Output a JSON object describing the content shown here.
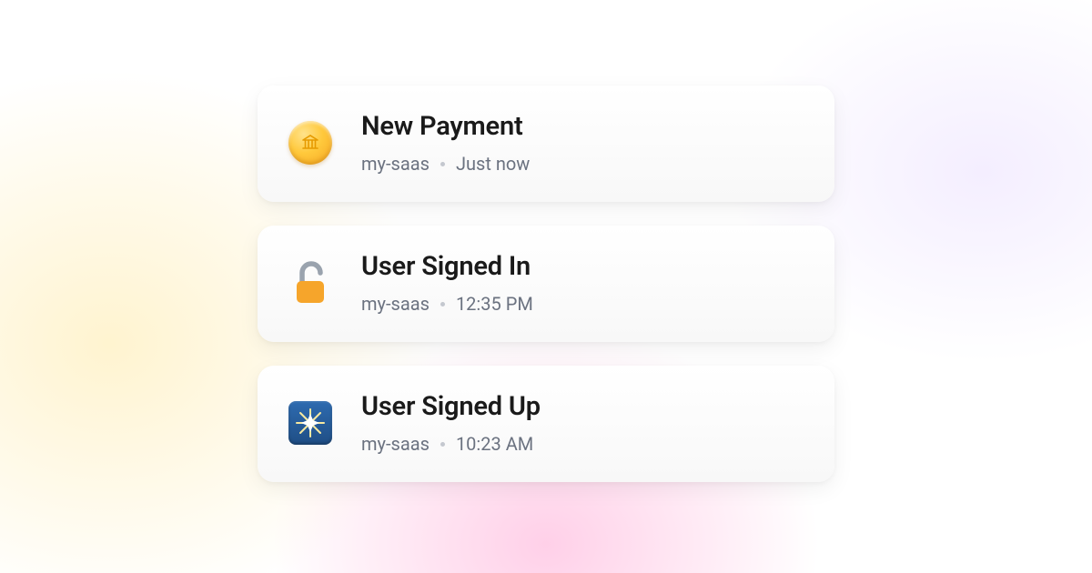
{
  "feed": {
    "items": [
      {
        "title": "New Payment",
        "project": "my-saas",
        "time": "Just now",
        "icon": "coin-bank-icon"
      },
      {
        "title": "User Signed In",
        "project": "my-saas",
        "time": "12:35 PM",
        "icon": "unlocked-lock-icon"
      },
      {
        "title": "User Signed Up",
        "project": "my-saas",
        "time": "10:23 AM",
        "icon": "sparkle-star-icon"
      }
    ]
  }
}
